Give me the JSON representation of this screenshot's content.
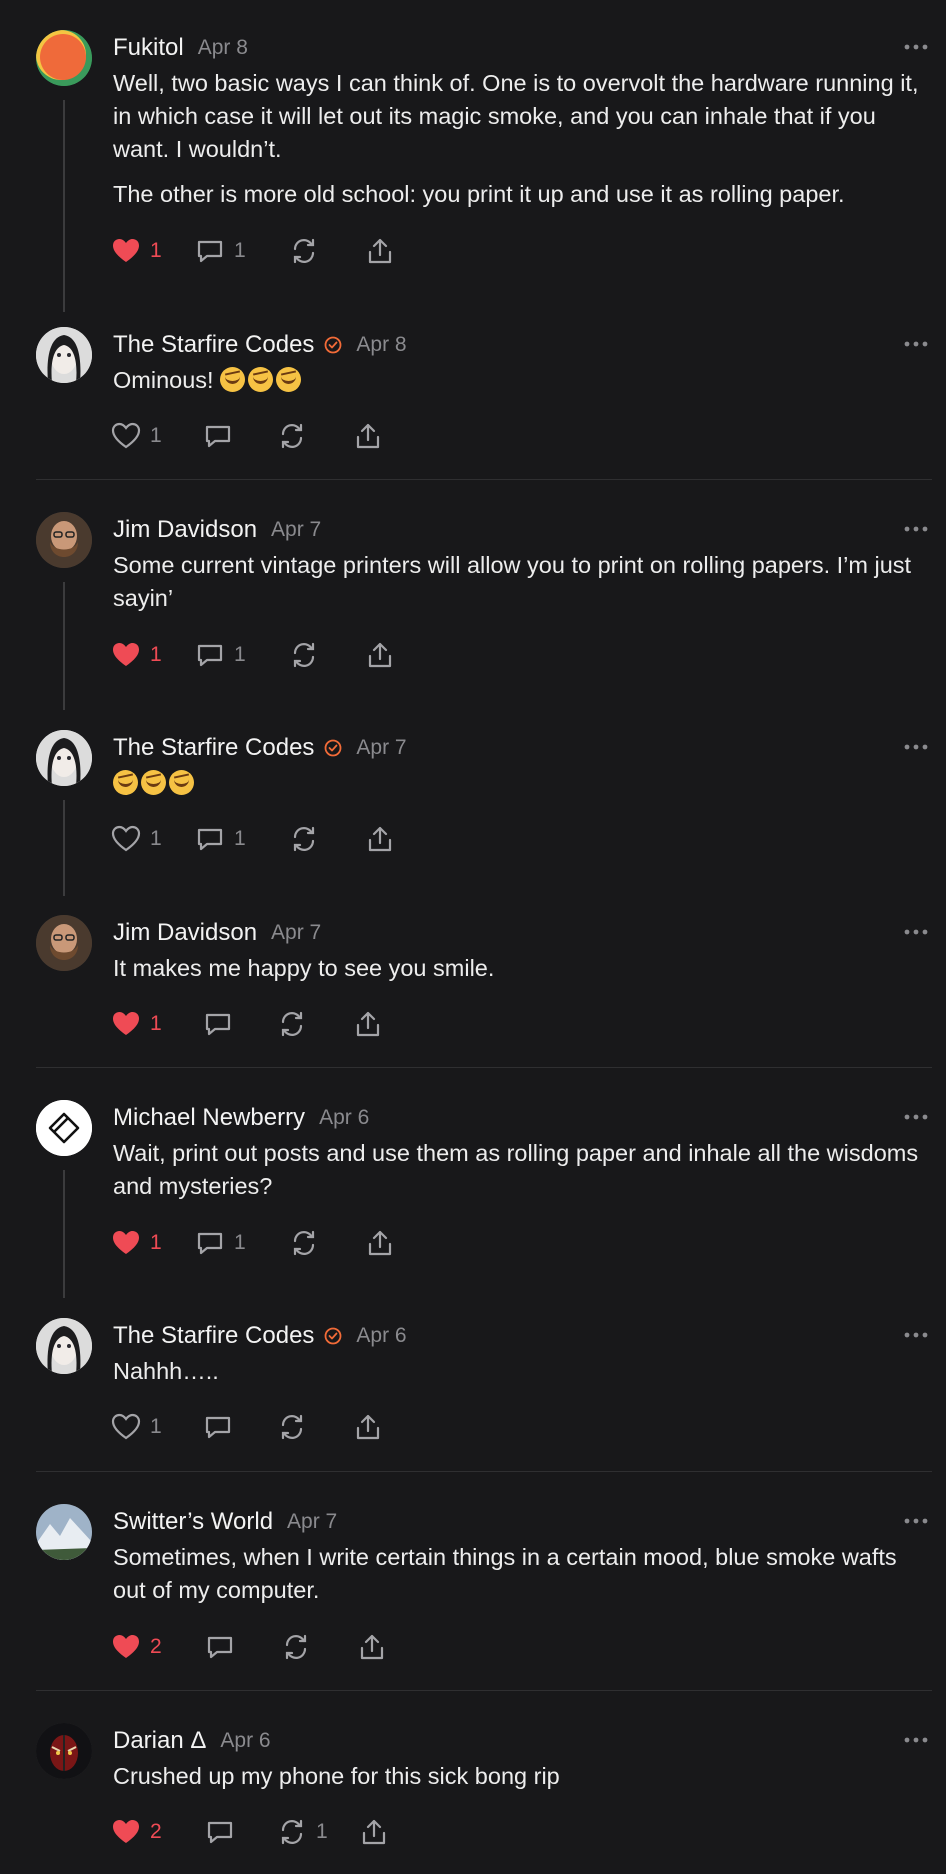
{
  "posts": [
    {
      "author": "Fukitol",
      "date": "Apr 8",
      "verified": false,
      "body": [
        "Well, two basic ways I can think of. One is to overvolt the hardware running it, in which case it will let out its magic smoke, and you can inhale that if you want. I wouldn’t.",
        "The other is more old school: you print it up and use it as rolling paper."
      ],
      "likes": "1",
      "liked": true,
      "replies": "1",
      "reposts": ""
    },
    {
      "author": "The Starfire Codes",
      "date": "Apr 8",
      "verified": true,
      "body": [
        "Ominous!"
      ],
      "emoji_count": 3,
      "likes": "1",
      "liked": false,
      "replies": "",
      "reposts": ""
    },
    {
      "author": "Jim Davidson",
      "date": "Apr 7",
      "verified": false,
      "body": [
        "Some current vintage printers will allow you to print on rolling papers. I’m just sayin’"
      ],
      "likes": "1",
      "liked": true,
      "replies": "1",
      "reposts": ""
    },
    {
      "author": "The Starfire Codes",
      "date": "Apr 7",
      "verified": true,
      "body": [
        ""
      ],
      "emoji_count": 3,
      "likes": "1",
      "liked": false,
      "replies": "1",
      "reposts": ""
    },
    {
      "author": "Jim Davidson",
      "date": "Apr 7",
      "verified": false,
      "body": [
        "It makes me happy to see you smile."
      ],
      "likes": "1",
      "liked": true,
      "replies": "",
      "reposts": ""
    },
    {
      "author": "Michael Newberry",
      "date": "Apr 6",
      "verified": false,
      "body": [
        "Wait, print out posts and use them as rolling paper and inhale all the wisdoms and mysteries?"
      ],
      "likes": "1",
      "liked": true,
      "replies": "1",
      "reposts": ""
    },
    {
      "author": "The Starfire Codes",
      "date": "Apr 6",
      "verified": true,
      "body": [
        "Nahhh….."
      ],
      "likes": "1",
      "liked": false,
      "replies": "",
      "reposts": ""
    },
    {
      "author": "Switter’s World",
      "date": "Apr 7",
      "verified": false,
      "body": [
        "Sometimes, when I write certain things in a certain mood, blue smoke wafts out of my computer."
      ],
      "likes": "2",
      "liked": true,
      "replies": "",
      "reposts": ""
    },
    {
      "author": "Darian Δ",
      "date": "Apr 6",
      "verified": false,
      "body": [
        "Crushed up my phone for this sick bong rip"
      ],
      "likes": "2",
      "liked": true,
      "replies": "",
      "reposts": "1"
    }
  ],
  "colors": {
    "background": "#18181a",
    "like": "#ef4b55",
    "verified": "#f26b38",
    "muted": "#8a8a8e"
  },
  "icons": {
    "like": "heart-icon",
    "reply": "comment-icon",
    "repost": "repost-icon",
    "share": "share-icon",
    "more": "more-icon",
    "verified": "verified-badge-icon"
  }
}
